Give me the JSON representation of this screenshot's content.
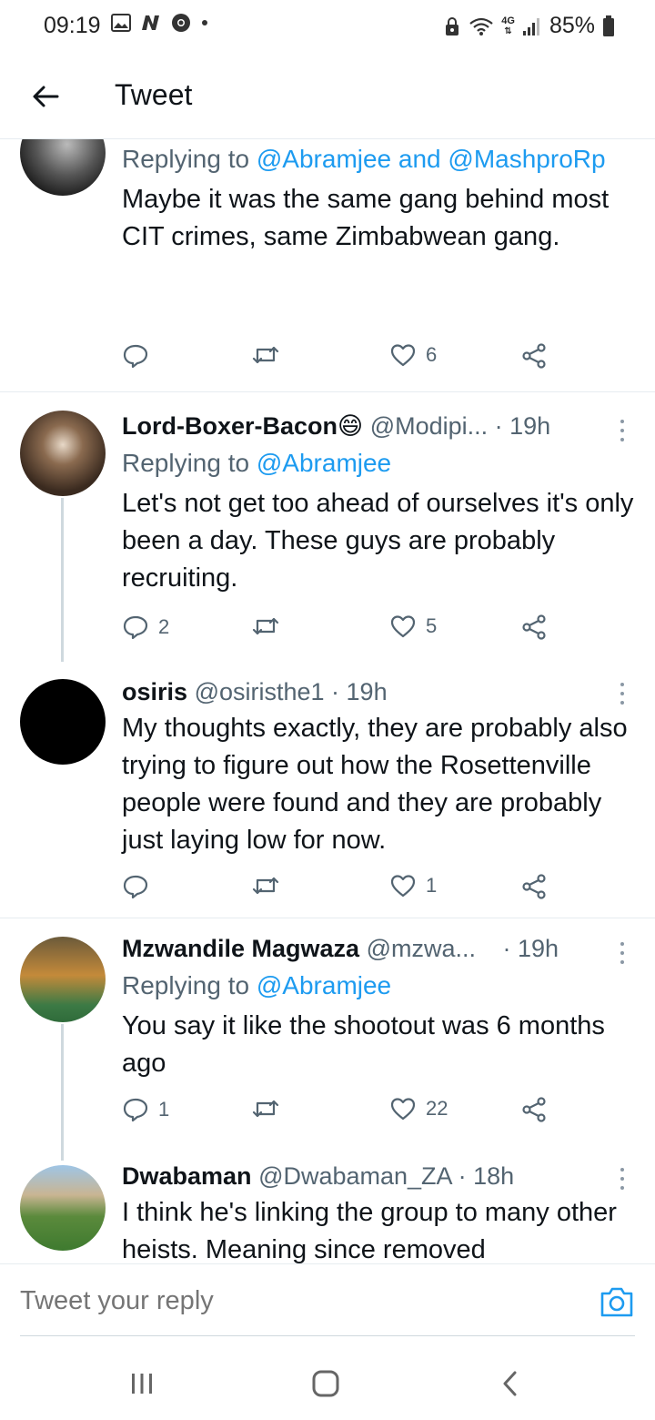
{
  "status_bar": {
    "time": "09:19",
    "battery": "85%",
    "network": "4G"
  },
  "header": {
    "title": "Tweet"
  },
  "tweets": [
    {
      "replying_prefix": "Replying to ",
      "replying_to": "@Abramjee and @MashproRp",
      "text": "Maybe it was the same gang behind most CIT crimes, same Zimbabwean gang.",
      "replies": "",
      "retweets": "",
      "likes": "6"
    },
    {
      "name": "Lord-Boxer-Bacon",
      "emoji": "😄",
      "handle": "@Modipi...",
      "time": "· 19h",
      "replying_prefix": "Replying to ",
      "replying_to": "@Abramjee",
      "text": "Let's not get too ahead of ourselves it's only been a day. These guys are probably recruiting.",
      "replies": "2",
      "retweets": "",
      "likes": "5"
    },
    {
      "name": "osiris",
      "handle": "@osiristhe1",
      "time": "· 19h",
      "text": "My thoughts exactly, they are probably also trying to figure out how the Rosettenville people were found and they are probably just laying low for now.",
      "replies": "",
      "retweets": "",
      "likes": "1"
    },
    {
      "name": "Mzwandile Magwaza",
      "handle": "@mzwa...",
      "time": "· 19h",
      "replying_prefix": "Replying to ",
      "replying_to": "@Abramjee",
      "text": "You say it like the shootout was 6 months ago",
      "replies": "1",
      "retweets": "",
      "likes": "22"
    },
    {
      "name": "Dwabaman",
      "handle": "@Dwabaman_ZA",
      "time": "· 18h",
      "text": "I think he's linking the group to many other heists. Meaning since removed"
    }
  ],
  "reply_bar": {
    "placeholder": "Tweet your reply"
  },
  "colors": {
    "accent": "#1d9bf0",
    "secondary_text": "#536471",
    "divider": "#e6ecf0"
  }
}
